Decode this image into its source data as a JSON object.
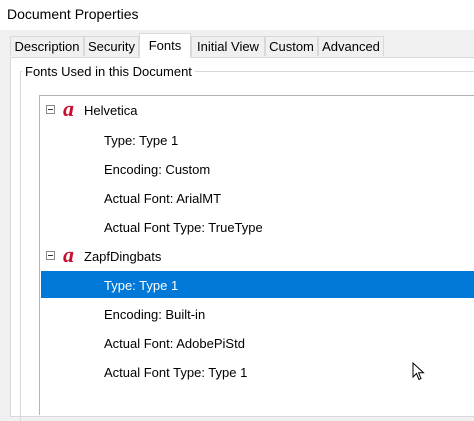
{
  "window": {
    "title": "Document Properties"
  },
  "tabs": [
    {
      "label": "Description"
    },
    {
      "label": "Security"
    },
    {
      "label": "Fonts"
    },
    {
      "label": "Initial View"
    },
    {
      "label": "Custom"
    },
    {
      "label": "Advanced"
    }
  ],
  "active_tab": "Fonts",
  "group": {
    "label": "Fonts Used in this Document"
  },
  "fonts": [
    {
      "name": "Helvetica",
      "type": "Type: Type 1",
      "encoding": "Encoding: Custom",
      "actual_font": "Actual Font: ArialMT",
      "actual_font_type": "Actual Font Type: TrueType"
    },
    {
      "name": "ZapfDingbats",
      "type": "Type: Type 1",
      "encoding": "Encoding: Built-in",
      "actual_font": "Actual Font: AdobePiStd",
      "actual_font_type": "Actual Font Type: Type 1"
    }
  ],
  "selected_item": "fonts.1.type",
  "colors": {
    "selection": "#0078d7",
    "font_icon": "#c8102e"
  },
  "icons": {
    "font": "adobe-font-icon",
    "collapse": "collapse-minus-icon",
    "cursor": "mouse-pointer-icon"
  }
}
